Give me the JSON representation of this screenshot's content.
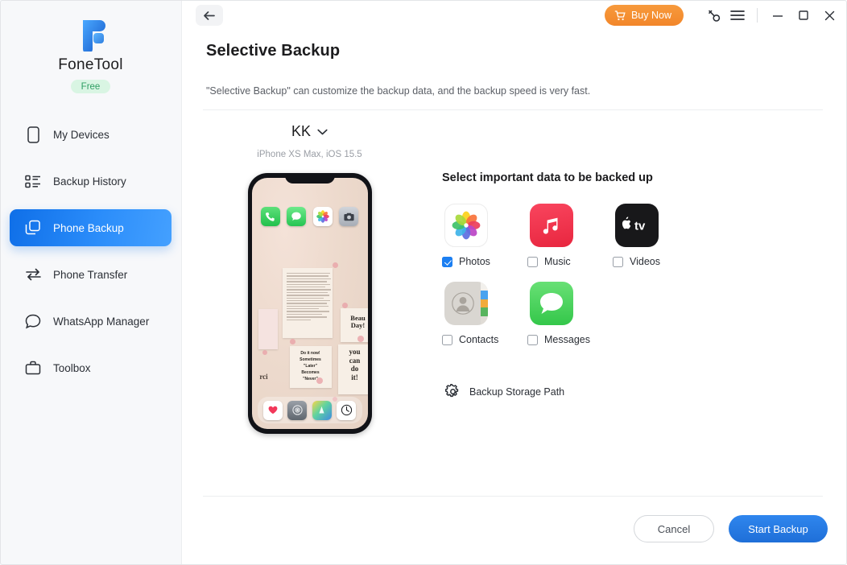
{
  "app": {
    "brand_name": "FoneTool",
    "plan_badge": "Free"
  },
  "sidebar": {
    "items": [
      {
        "label": "My Devices",
        "icon": "device-icon",
        "active": false
      },
      {
        "label": "Backup History",
        "icon": "list-icon",
        "active": false
      },
      {
        "label": "Phone Backup",
        "icon": "layers-icon",
        "active": true
      },
      {
        "label": "Phone Transfer",
        "icon": "transfer-icon",
        "active": false
      },
      {
        "label": "WhatsApp Manager",
        "icon": "chat-icon",
        "active": false
      },
      {
        "label": "Toolbox",
        "icon": "toolbox-icon",
        "active": false
      }
    ]
  },
  "titlebar": {
    "back_label": "back-arrow",
    "buy_now_label": "Buy Now",
    "key_icon": "key-icon",
    "menu_icon": "hamburger-icon",
    "minimize_icon": "minimize-icon",
    "maximize_icon": "maximize-icon",
    "close_icon": "close-icon"
  },
  "page": {
    "title": "Selective Backup",
    "description": "\"Selective Backup\" can customize the backup data, and the backup speed is very fast."
  },
  "device": {
    "name": "KK",
    "chevron": "chevron-down-icon",
    "subtitle": "iPhone XS Max, iOS 15.5",
    "home_screen": {
      "top_apps": [
        "phone-app",
        "messages-app",
        "photos-app",
        "camera-app"
      ],
      "dock_apps": [
        "health-app",
        "settings-app",
        "appstore-app",
        "clock-app"
      ],
      "wallpaper_texts": [
        "Beau",
        "Day!",
        "you",
        "can",
        "do",
        "it!",
        "Do it now!",
        "Sometimes",
        "\"Later\"",
        "Becomes",
        "\"Never\""
      ]
    }
  },
  "selection": {
    "heading": "Select important data to be backed up",
    "items": [
      {
        "label": "Photos",
        "icon": "photos-app-icon",
        "checked": true
      },
      {
        "label": "Music",
        "icon": "music-app-icon",
        "checked": false
      },
      {
        "label": "Videos",
        "icon": "appletv-app-icon",
        "checked": false
      },
      {
        "label": "Contacts",
        "icon": "contacts-app-icon",
        "checked": false
      },
      {
        "label": "Messages",
        "icon": "messages-app-icon",
        "checked": false
      }
    ],
    "storage_path_label": "Backup Storage Path",
    "storage_path_icon": "gear-icon"
  },
  "footer": {
    "cancel_label": "Cancel",
    "start_label": "Start Backup"
  },
  "annotation": {
    "highlight_color": "#d9342b",
    "target": "Start Backup"
  },
  "colors": {
    "accent_blue": "#1c7ff2",
    "buy_orange": "#f2862a",
    "free_green": "#2f9e63",
    "sidebar_bg": "#f7f8fa"
  }
}
